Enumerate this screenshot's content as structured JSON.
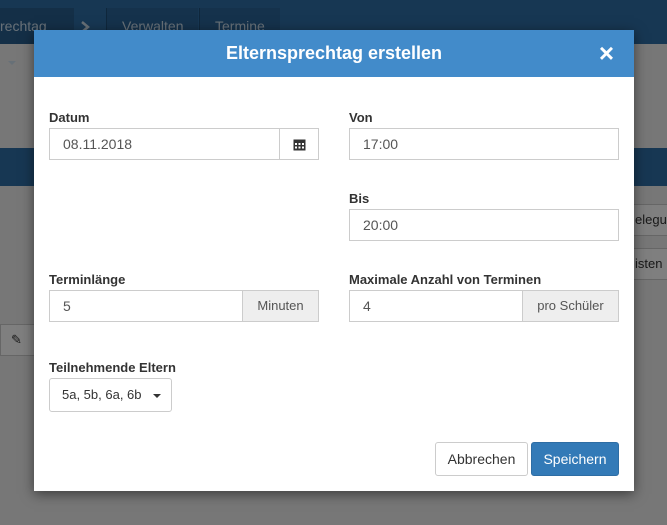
{
  "background": {
    "breadcrumb_label": "rechtag",
    "tabs": [
      {
        "label": "Verwalten"
      },
      {
        "label": "Termine"
      }
    ],
    "side_button_1": "elegu",
    "side_button_2": "isten"
  },
  "modal": {
    "title": "Elternsprechtag erstellen",
    "close_symbol": "×",
    "datum": {
      "label": "Datum",
      "value": "08.11.2018"
    },
    "von": {
      "label": "Von",
      "value": "17:00"
    },
    "bis": {
      "label": "Bis",
      "value": "20:00"
    },
    "terminlaenge": {
      "label": "Terminlänge",
      "value": "5",
      "unit": "Minuten"
    },
    "max_termine": {
      "label": "Maximale Anzahl von Terminen",
      "value": "4",
      "unit": "pro Schüler"
    },
    "teilnehmende": {
      "label": "Teilnehmende Eltern",
      "value": "5a, 5b, 6a, 6b"
    },
    "cancel_label": "Abbrechen",
    "save_label": "Speichern"
  },
  "colors": {
    "header": "#428bca",
    "primary_button": "#337ab7",
    "topbar": "#2f6fa6"
  }
}
